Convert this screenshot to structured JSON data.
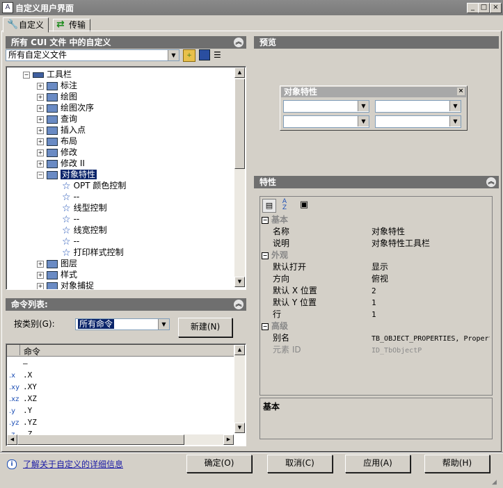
{
  "window": {
    "title": "自定义用户界面",
    "min": "_",
    "max": "□",
    "close": "×"
  },
  "tabs": [
    {
      "label": "自定义"
    },
    {
      "label": "传输"
    }
  ],
  "cui_panel": {
    "title": "所有 CUI 文件 中的自定义",
    "file_select": "所有自定义文件",
    "tree": {
      "root": "工具栏",
      "items": [
        "标注",
        "绘图",
        "绘图次序",
        "查询",
        "插入点",
        "布局",
        "修改",
        "修改 II",
        "对象特性"
      ],
      "children": [
        "OPT 颜色控制",
        "--",
        "线型控制",
        "--",
        "线宽控制",
        "--",
        "打印样式控制"
      ],
      "after": [
        "图层",
        "样式",
        "对象捕捉"
      ]
    }
  },
  "command_panel": {
    "title": "命令列表:",
    "filter_label": "按类别(G):",
    "filter_value": "所有命令",
    "new_button": "新建(N)",
    "column": "命令",
    "rows": [
      {
        "icon": "",
        "name": "–"
      },
      {
        "icon": ".x",
        "name": ".X"
      },
      {
        "icon": ".xy",
        "name": ".XY"
      },
      {
        "icon": ".xz",
        "name": ".XZ"
      },
      {
        "icon": ".y",
        "name": ".Y"
      },
      {
        "icon": ".yz",
        "name": ".YZ"
      },
      {
        "icon": ".z",
        "name": ".Z"
      }
    ]
  },
  "preview_panel": {
    "title": "预览",
    "toolbar_title": "对象特性"
  },
  "properties_panel": {
    "title": "特性",
    "sections": [
      {
        "name": "基本",
        "rows": [
          {
            "k": "名称",
            "v": "对象特性"
          },
          {
            "k": "说明",
            "v": "对象特性工具栏"
          }
        ]
      },
      {
        "name": "外观",
        "rows": [
          {
            "k": "默认打开",
            "v": "显示"
          },
          {
            "k": "方向",
            "v": "俯视"
          },
          {
            "k": "默认 X 位置",
            "v": "2"
          },
          {
            "k": "默认 Y 位置",
            "v": "1"
          },
          {
            "k": "行",
            "v": "1"
          }
        ]
      },
      {
        "name": "高级",
        "rows": [
          {
            "k": "别名",
            "v": "TB_OBJECT_PROPERTIES, Propert"
          },
          {
            "k": "元素 ID",
            "v": "ID_TbObjectP"
          }
        ]
      }
    ],
    "description_title": "基本"
  },
  "footer": {
    "info_link": "了解关于自定义的详细信息",
    "ok": "确定(O)",
    "cancel": "取消(C)",
    "apply": "应用(A)",
    "help": "帮助(H)"
  }
}
